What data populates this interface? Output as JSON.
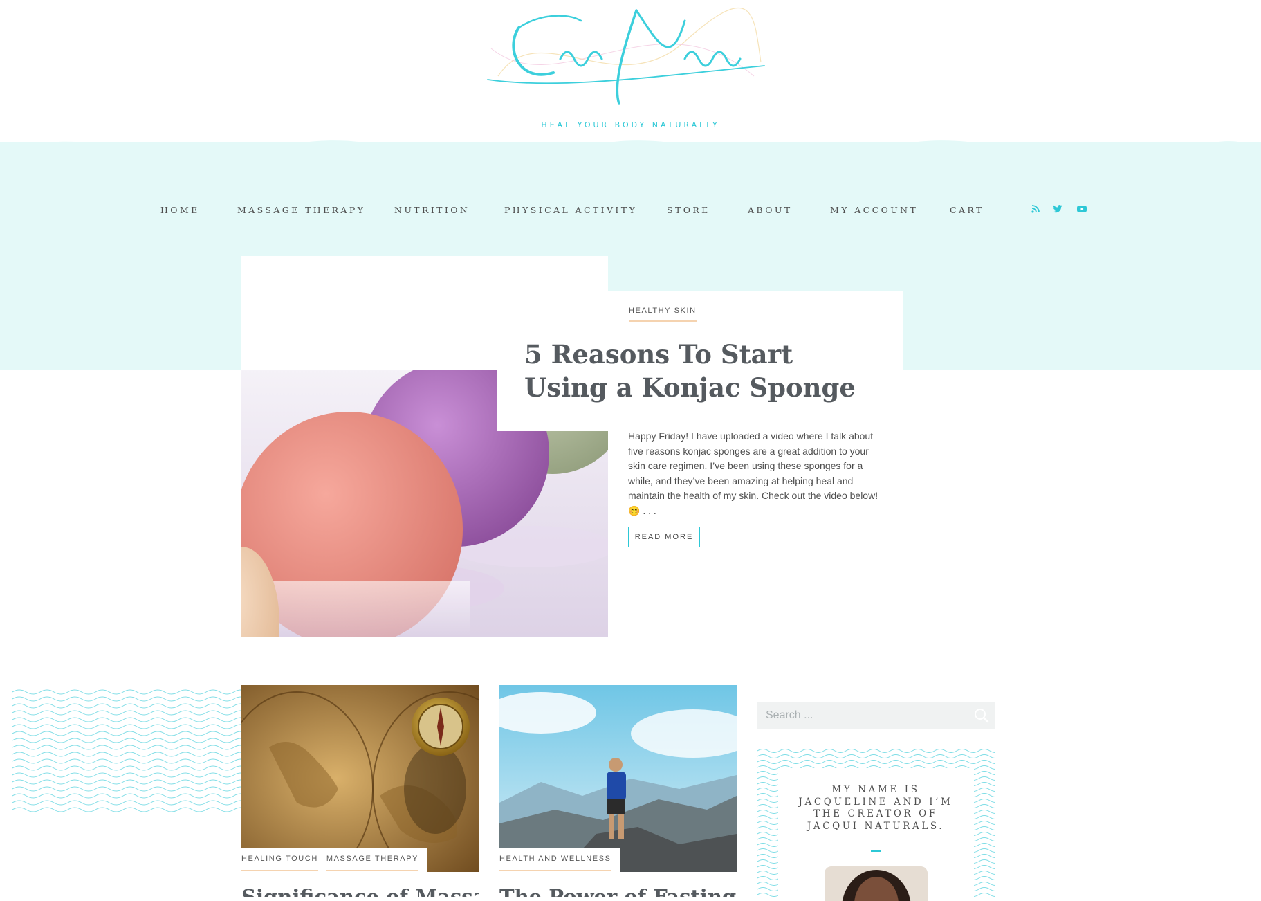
{
  "site": {
    "logo_text": "Jacqui Naturals",
    "tagline": "HEAL YOUR BODY NATURALLY"
  },
  "nav": {
    "items": [
      "HOME",
      "MASSAGE THERAPY",
      "NUTRITION",
      "PHYSICAL ACTIVITY",
      "STORE",
      "ABOUT",
      "MY ACCOUNT",
      "CART"
    ],
    "social_icons": [
      "rss-icon",
      "twitter-icon",
      "youtube-icon"
    ]
  },
  "featured": {
    "category": "HEALTHY SKIN",
    "title": "5 Reasons To Start Using a Konjac Sponge",
    "excerpt": "Happy Friday! I have uploaded a video where I talk about five reasons konjac sponges are a great addition to your skin care regimen. I’ve been using these sponges for a while, and they’ve been amazing at helping heal and maintain the health of my skin.  Check out the video below! 😊     . . .",
    "read_more": "READ MORE"
  },
  "posts": [
    {
      "categories": [
        "HEALING TOUCH",
        "MASSAGE THERAPY"
      ],
      "title": "Significance of Massage"
    },
    {
      "categories": [
        "HEALTH AND WELLNESS"
      ],
      "title": "The Power of Fasting for"
    }
  ],
  "sidebar": {
    "search_placeholder": "Search ...",
    "about_text": "MY NAME IS JACQUELINE AND I’M THE CREATOR OF JACQUI NATURALS."
  },
  "colors": {
    "accent": "#2dc8d6",
    "band": "#e4f9f8",
    "tag_underline": "#f5d3b0"
  }
}
